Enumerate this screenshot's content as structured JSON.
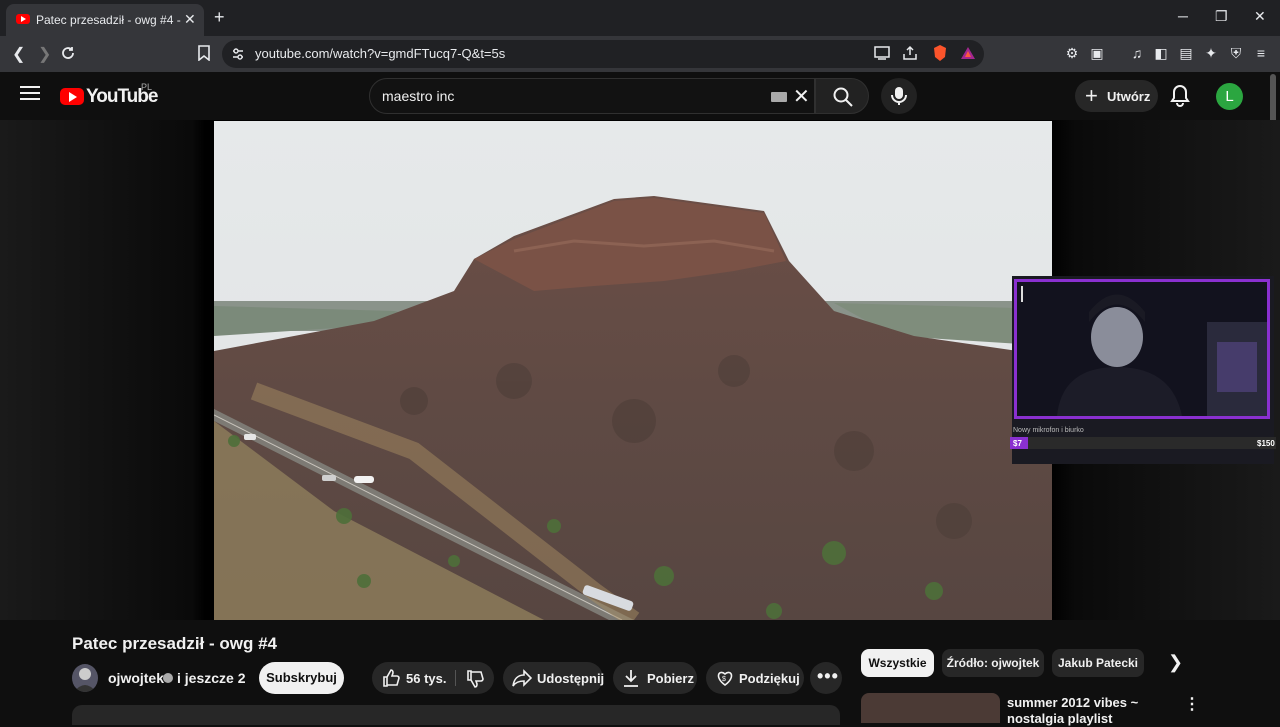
{
  "browser": {
    "tab_title": "Patec przesadził - owg #4 - YouT",
    "tab_close": "✕",
    "new_tab": "+",
    "url": "youtube.com/watch?v=gmdFTucq7-Q&t=5s",
    "window_controls": [
      "─",
      "❐",
      "✕"
    ]
  },
  "youtube": {
    "logo_text": "YouTube",
    "country_code": "PL",
    "search_value": "maestro inc",
    "create_label": "Utwórz",
    "avatar_letter": "L",
    "avatar_color": "#2ba640"
  },
  "stream_overlay": {
    "goal_text": "Nowy mikrofon i biurko",
    "goal_current": "$7",
    "goal_target": "$150",
    "goal_progress": 0.047,
    "frame_color": "#8a30d0"
  },
  "video": {
    "title": "Patec przesadził - owg #4",
    "channel": "ojwojtek",
    "channel_extra": "i jeszcze 2",
    "subscribe_label": "Subskrybuj",
    "likes": "56 tys.",
    "share_label": "Udostępnij",
    "download_label": "Pobierz",
    "thanks_label": "Podziękuj",
    "more_label": "•••"
  },
  "sidebar": {
    "chips": [
      "Wszystkie",
      "Źródło: ojwojtek",
      "Jakub Patecki"
    ],
    "recommendation_title": "summer 2012 vibes ~ nostalgia playlist"
  }
}
